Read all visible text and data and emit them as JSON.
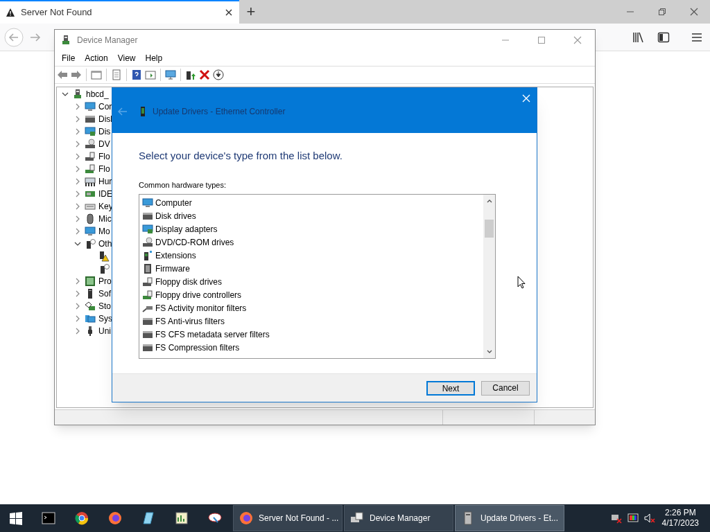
{
  "browser": {
    "tabs": [
      {
        "title": "Server Not Found",
        "selected": true
      }
    ],
    "new_tab": "+"
  },
  "device_manager": {
    "title": "Device Manager",
    "menu": [
      "File",
      "Action",
      "View",
      "Help"
    ],
    "tree": [
      {
        "label": "hbcd_",
        "expanded": true,
        "children": [
          {
            "label": "Cor",
            "expanded": false
          },
          {
            "label": "Disl",
            "expanded": false
          },
          {
            "label": "Dis",
            "expanded": false
          },
          {
            "label": "DV",
            "expanded": false
          },
          {
            "label": "Flo",
            "expanded": false
          },
          {
            "label": "Flo",
            "expanded": false
          },
          {
            "label": "Hur",
            "expanded": false
          },
          {
            "label": "IDE",
            "expanded": false
          },
          {
            "label": "Key",
            "expanded": false
          },
          {
            "label": "Mic",
            "expanded": false
          },
          {
            "label": "Mo",
            "expanded": false
          },
          {
            "label": "Oth",
            "expanded": true,
            "children": [
              {
                "kind": "warning"
              },
              {
                "kind": "unknown"
              }
            ]
          },
          {
            "label": "Pro",
            "expanded": false
          },
          {
            "label": "Sof",
            "expanded": false
          },
          {
            "label": "Sto",
            "expanded": false
          },
          {
            "label": "Sys",
            "expanded": false
          },
          {
            "label": "Uni",
            "expanded": false
          }
        ]
      }
    ]
  },
  "dialog": {
    "title": "Update Drivers - Ethernet Controller",
    "heading": "Select your device's type from the list below.",
    "list_label": "Common hardware types:",
    "items": [
      "Computer",
      "Disk drives",
      "Display adapters",
      "DVD/CD-ROM drives",
      "Extensions",
      "Firmware",
      "Floppy disk drives",
      "Floppy drive controllers",
      "FS Activity monitor filters",
      "FS Anti-virus filters",
      "FS CFS metadata server filters",
      "FS Compression filters"
    ],
    "buttons": [
      "Next",
      "Cancel"
    ]
  },
  "taskbar": {
    "buttons": [
      {
        "label": "Server Not Found - ...",
        "selected": false
      },
      {
        "label": "Device Manager",
        "selected": false
      },
      {
        "label": "Update Drivers - Et...",
        "selected": true
      }
    ],
    "time": "2:26 PM",
    "date": "4/17/2023"
  }
}
